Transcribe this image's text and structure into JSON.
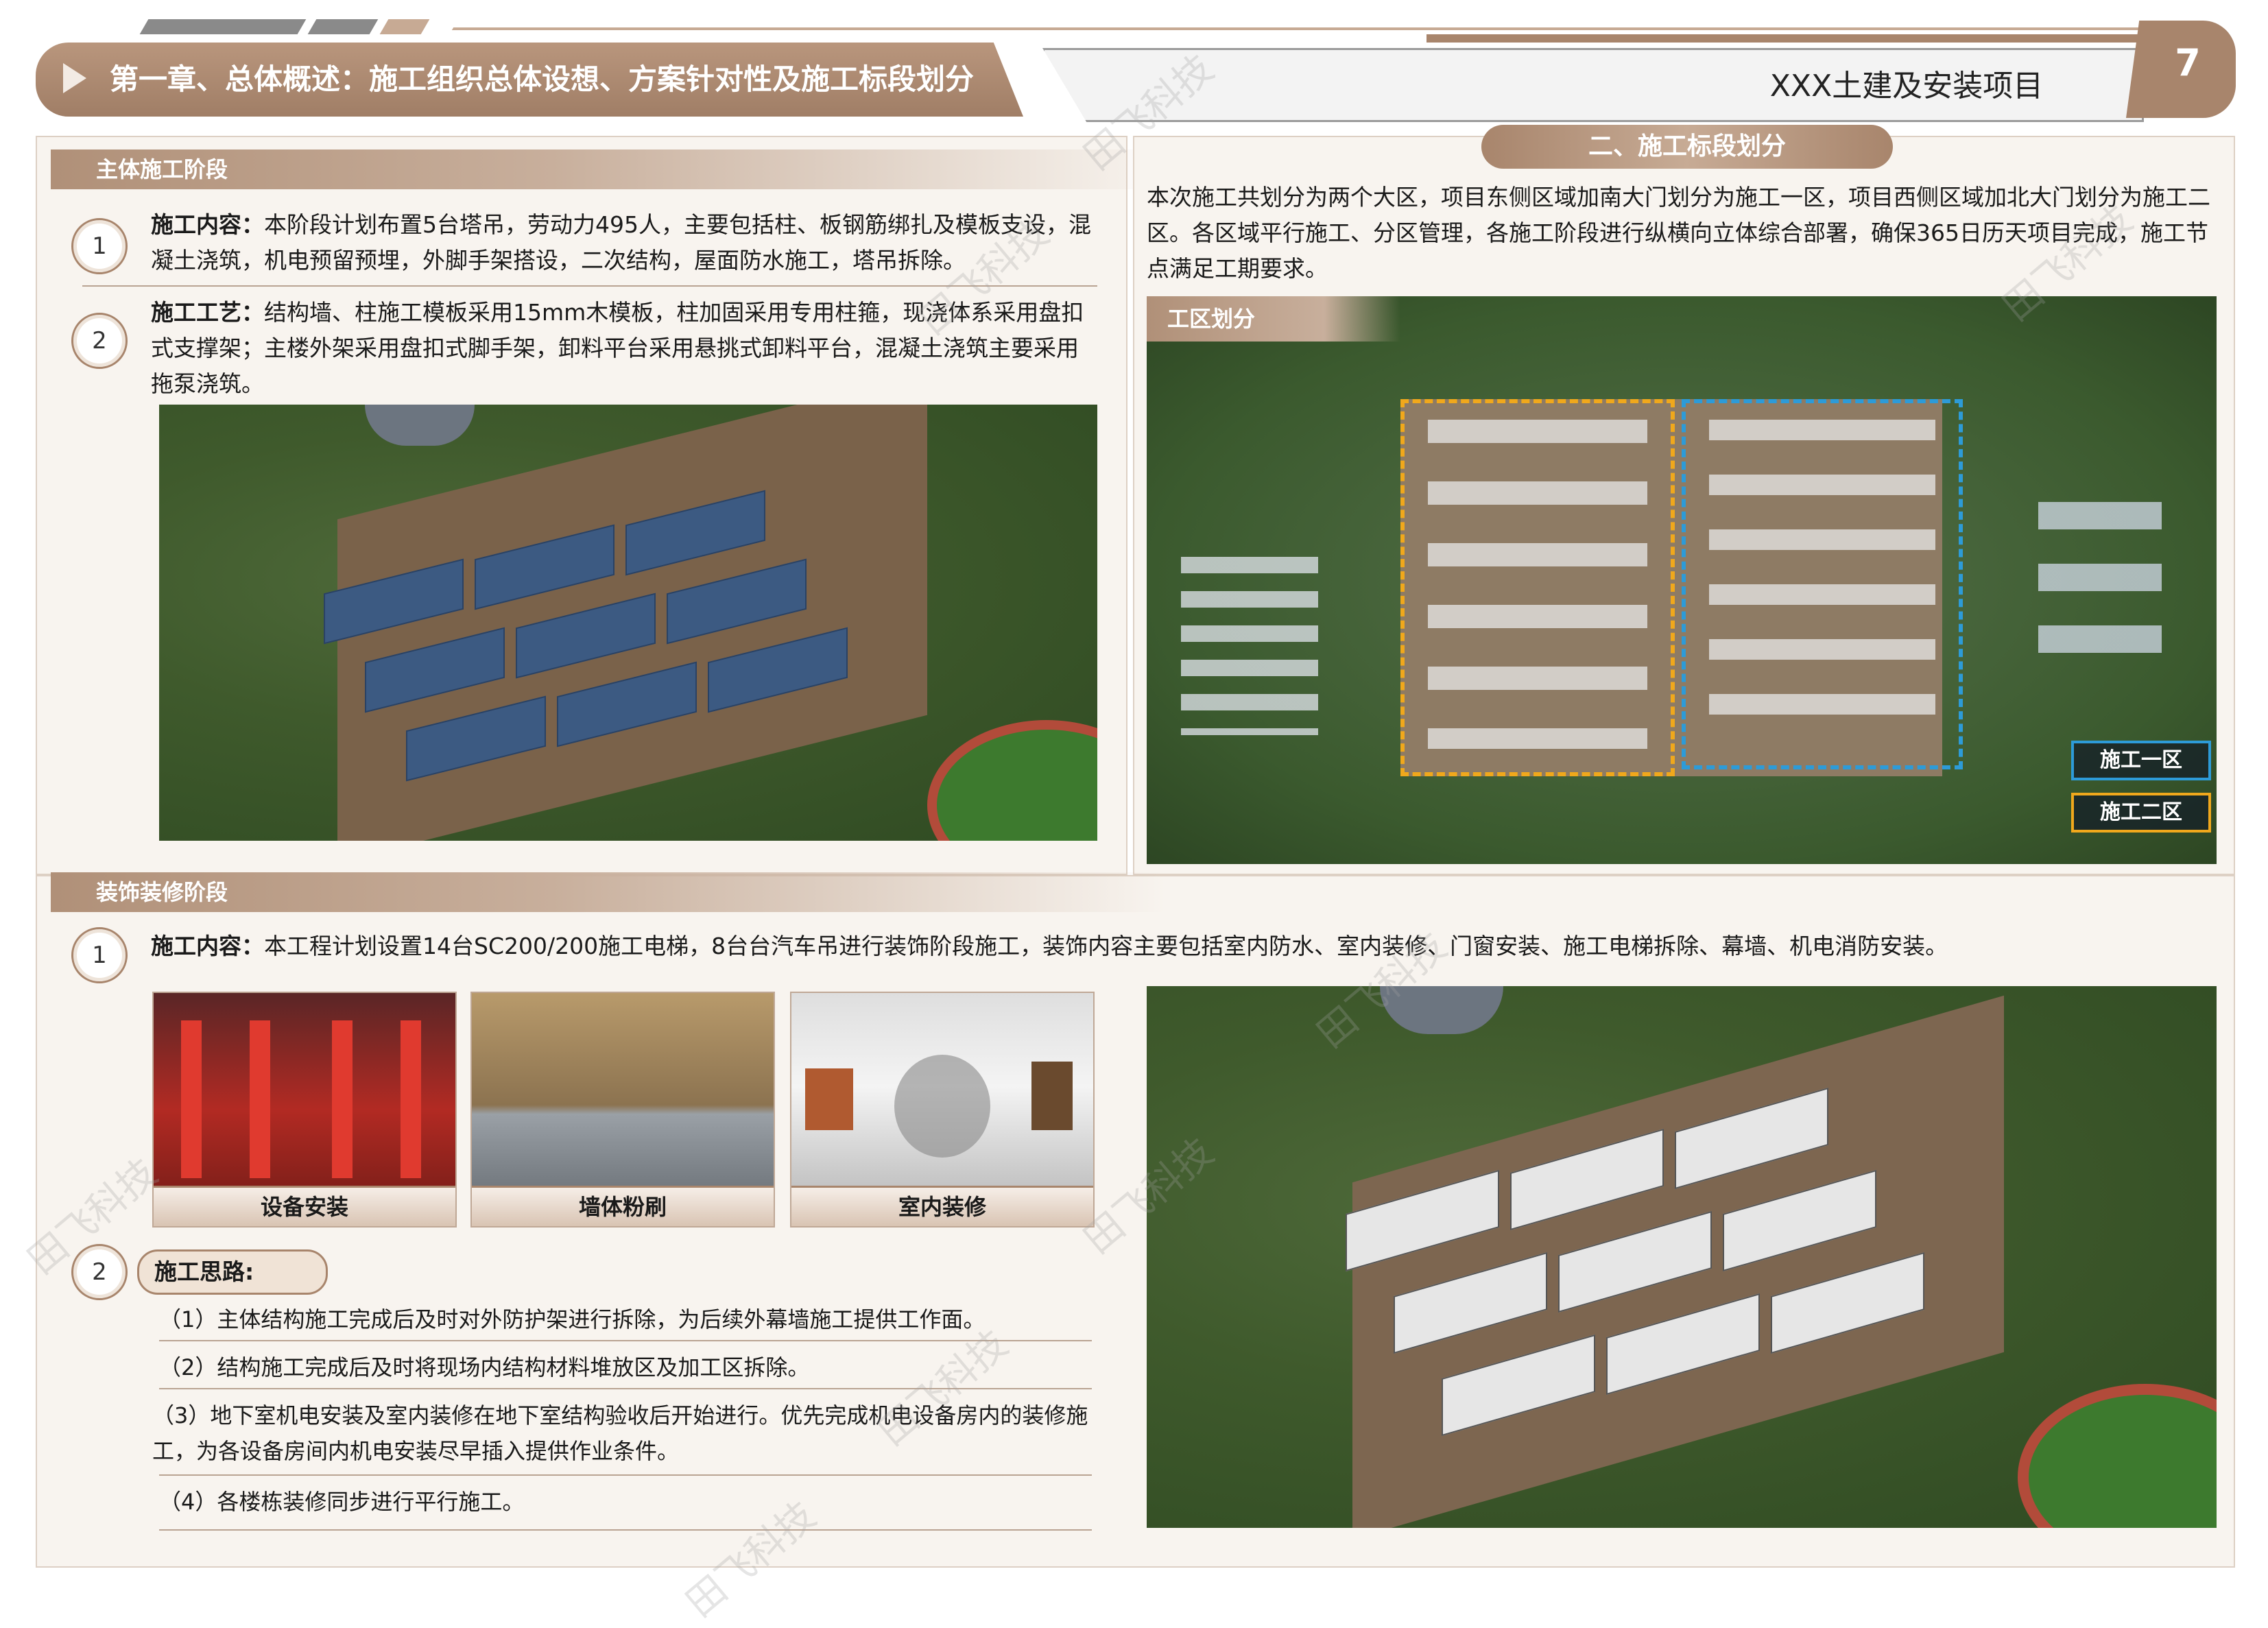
{
  "header": {
    "title": "第一章、总体概述：施工组织总体设想、方案针对性及施工标段划分",
    "project": "XXX土建及安装项目",
    "page": "7"
  },
  "main_stage": {
    "title": "主体施工阶段",
    "items": [
      {
        "num": "1",
        "label": "施工内容：",
        "text": "本阶段计划布置5台塔吊，劳动力495人，主要包括柱、板钢筋绑扎及模板支设，混凝土浇筑，机电预留预埋，外脚手架搭设，二次结构，屋面防水施工，塔吊拆除。"
      },
      {
        "num": "2",
        "label": "施工工艺：",
        "text": "结构墙、柱施工模板采用15mm木模板，柱加固采用专用柱箍，现浇体系采用盘扣式支撑架；主楼外架采用盘扣式脚手架，卸料平台采用悬挑式卸料平台，混凝土浇筑主要采用拖泵浇筑。"
      }
    ]
  },
  "section_division": {
    "title": "二、施工标段划分",
    "text": "本次施工共划分为两个大区，项目东侧区域加南大门划分为施工一区，项目西侧区域加北大门划分为施工二区。各区域平行施工、分区管理，各施工阶段进行纵横向立体综合部署，确保365日历天项目完成，施工节点满足工期要求。",
    "map_tag": "工区划分",
    "zone1": "施工一区",
    "zone2": "施工二区"
  },
  "decoration_stage": {
    "title": "装饰装修阶段",
    "item1": {
      "num": "1",
      "label": "施工内容：",
      "text": "本工程计划设置14台SC200/200施工电梯，8台台汽车吊进行装饰阶段施工，装饰内容主要包括室内防水、室内装修、门窗安装、施工电梯拆除、幕墙、机电消防安装。"
    },
    "thumbs": [
      "设备安装",
      "墙体粉刷",
      "室内装修"
    ],
    "item2": {
      "num": "2",
      "label": "施工思路:"
    },
    "ideas": [
      "（1）主体结构施工完成后及时对外防护架进行拆除，为后续外幕墙施工提供工作面。",
      "（2）结构施工完成后及时将现场内结构材料堆放区及加工区拆除。",
      "（3）地下室机电安装及室内装修在地下室结构验收后开始进行。优先完成机电设备房内的装修施工，为各设备房间内机电安装尽早插入提供作业条件。",
      "（4）各楼栋装修同步进行平行施工。"
    ]
  },
  "watermark": "田飞科技"
}
